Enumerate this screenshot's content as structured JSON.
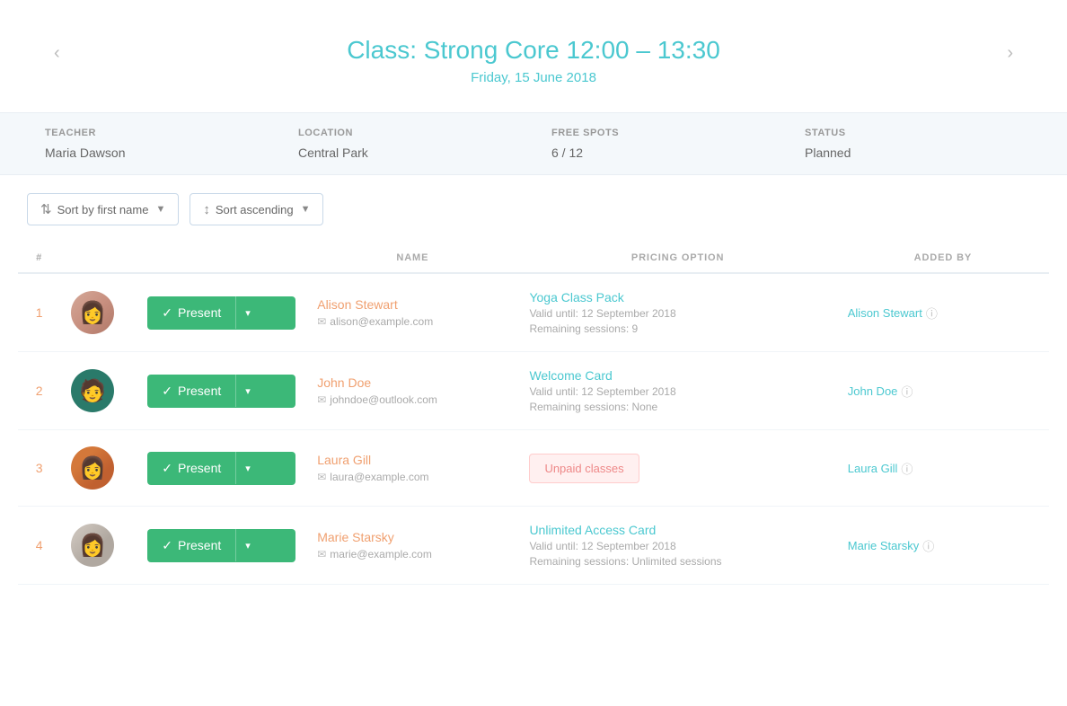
{
  "header": {
    "prev_label": "‹",
    "next_label": "›",
    "class_prefix": "Class: ",
    "class_name": "Strong Core 12:00 – 13:30",
    "date": "Friday, 15 June 2018"
  },
  "info_bar": {
    "teacher_label": "TEACHER",
    "teacher_value": "Maria Dawson",
    "location_label": "LOCATION",
    "location_value": "Central Park",
    "free_spots_label": "FREE SPOTS",
    "free_spots_value": "6 / 12",
    "status_label": "STATUS",
    "status_value": "Planned"
  },
  "sort_controls": {
    "sort_name_label": "Sort by first name",
    "sort_order_label": "Sort ascending"
  },
  "table": {
    "col_hash": "#",
    "col_name": "NAME",
    "col_pricing": "PRICING OPTION",
    "col_added": "ADDED BY",
    "present_label": "Present",
    "rows": [
      {
        "num": "1",
        "name": "Alison Stewart",
        "email": "alison@example.com",
        "pricing_name": "Yoga Class Pack",
        "pricing_valid": "Valid until: 12 September 2018",
        "pricing_sessions": "Remaining sessions: 9",
        "added_by": "Alison Stewart",
        "avatar_class": "avatar-1",
        "unpaid": false
      },
      {
        "num": "2",
        "name": "John Doe",
        "email": "johndoe@outlook.com",
        "pricing_name": "Welcome Card",
        "pricing_valid": "Valid until: 12 September 2018",
        "pricing_sessions": "Remaining sessions: None",
        "added_by": "John Doe",
        "avatar_class": "avatar-2",
        "unpaid": false
      },
      {
        "num": "3",
        "name": "Laura Gill",
        "email": "laura@example.com",
        "pricing_name": "Unpaid classes",
        "pricing_valid": "",
        "pricing_sessions": "",
        "added_by": "Laura Gill",
        "avatar_class": "avatar-3",
        "unpaid": true
      },
      {
        "num": "4",
        "name": "Marie Starsky",
        "email": "marie@example.com",
        "pricing_name": "Unlimited Access Card",
        "pricing_valid": "Valid until: 12 September 2018",
        "pricing_sessions": "Remaining sessions: Unlimited sessions",
        "added_by": "Marie Starsky",
        "avatar_class": "avatar-4",
        "unpaid": false
      }
    ]
  }
}
